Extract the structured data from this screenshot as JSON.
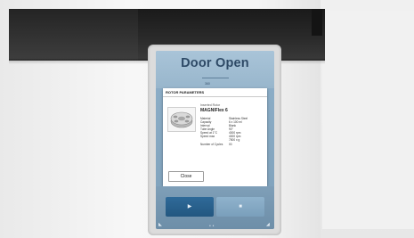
{
  "screen": {
    "title": "Door Open",
    "header_label": "360"
  },
  "dialog": {
    "title": "ROTOR PARAMETERS",
    "rotor_header": "Inserted Rotor",
    "rotor_name": "MAGNIFlex 6",
    "params": [
      {
        "label": "Material",
        "value": "Stainless Steel"
      },
      {
        "label": "Capacity",
        "value": "6 x 100 ml"
      },
      {
        "label": "Interval",
        "value": "Blank"
      },
      {
        "label": "Tube Angle",
        "value": "90°"
      },
      {
        "label": "Speed at 1°C",
        "value": "4000 rpm"
      },
      {
        "label": "Speed max",
        "value": "4000 rpm"
      },
      {
        "label": "",
        "value": "7500 x g"
      },
      {
        "label": "Number of Cycles",
        "value": "00"
      }
    ],
    "close_label": "Close"
  },
  "controls": {
    "start_glyph": "▶",
    "stop_glyph": "■",
    "left_icon": "◣",
    "right_icon": "◢",
    "page_dots": "● ●"
  },
  "colors": {
    "screen_bg": "#8fb0c9",
    "title_text": "#2e4a66",
    "start_button": "#2f6a99",
    "stop_button": "#8fb2cc",
    "lid": "#1a1a1a"
  },
  "icons": {
    "rotor": "rotor-image-icon",
    "start": "play-icon",
    "stop": "stop-icon"
  }
}
